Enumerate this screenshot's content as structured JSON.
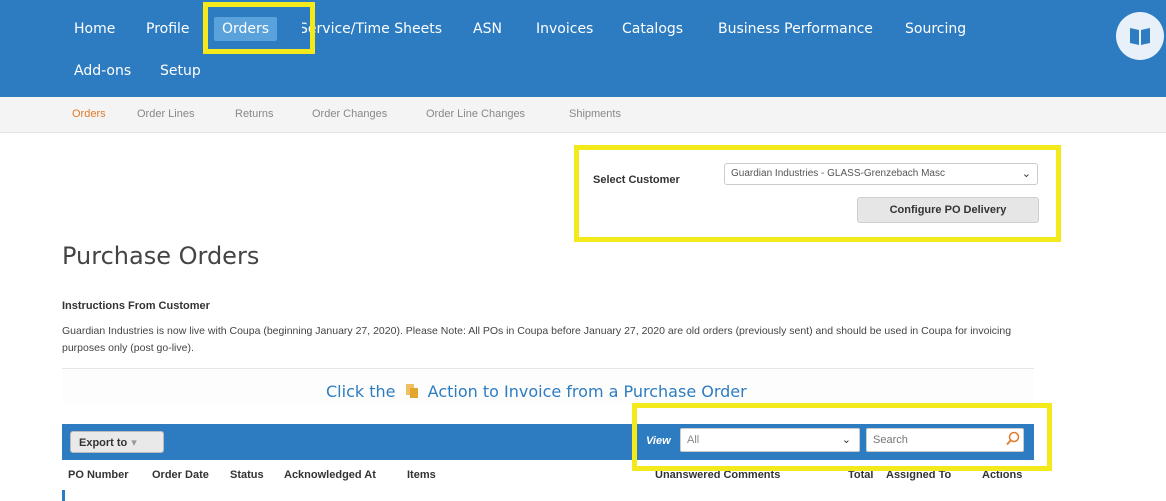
{
  "nav": {
    "items": [
      "Home",
      "Profile",
      "Orders",
      "Service/Time Sheets",
      "ASN",
      "Invoices",
      "Catalogs",
      "Business Performance",
      "Sourcing",
      "Add-ons",
      "Setup"
    ],
    "active": "Orders"
  },
  "subnav": {
    "items": [
      "Orders",
      "Order Lines",
      "Returns",
      "Order Changes",
      "Order Line Changes",
      "Shipments"
    ],
    "active": "Orders"
  },
  "customer": {
    "label": "Select Customer",
    "selected": "Guardian Industries - GLASS-Grenzebach Masc",
    "configure_button": "Configure PO Delivery"
  },
  "page": {
    "title": "Purchase Orders",
    "instructions_title": "Instructions From Customer",
    "instructions_text": "Guardian Industries is now live with Coupa (beginning January 27, 2020). Please Note: All POs in Coupa before January 27, 2020 are old orders (previously sent) and should be used in Coupa for invoicing purposes only (post go-live).",
    "banner_before": "Click the",
    "banner_after": "Action to Invoice from a Purchase Order"
  },
  "table": {
    "export_label": "Export to",
    "view_label": "View",
    "view_selected": "All",
    "search_placeholder": "Search",
    "columns": [
      "PO Number",
      "Order Date",
      "Status",
      "Acknowledged At",
      "Items",
      "Unanswered Comments",
      "Total",
      "Assigned To",
      "Actions"
    ]
  },
  "colors": {
    "nav_bg": "#2d7cc1",
    "nav_active_bg": "#5aa2dc",
    "highlight": "#f4ea1b",
    "subnav_active": "#e07b2a"
  }
}
